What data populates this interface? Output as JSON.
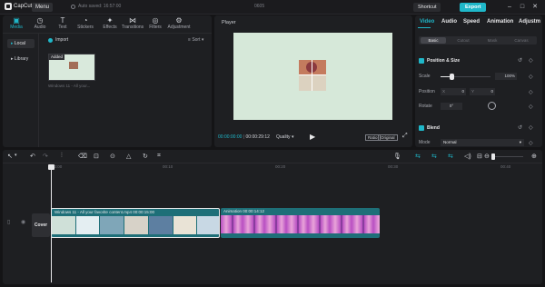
{
  "app": {
    "name": "CapCut",
    "menu": "Menu",
    "autosave": "Auto saved: 16:57:00",
    "project": "0605",
    "shortcut": "Shortcut",
    "export": "Export"
  },
  "toolbar": [
    {
      "label": "Media",
      "icon": "media-icon"
    },
    {
      "label": "Audio",
      "icon": "audio-icon"
    },
    {
      "label": "Text",
      "icon": "text-icon"
    },
    {
      "label": "Stickers",
      "icon": "stickers-icon"
    },
    {
      "label": "Effects",
      "icon": "effects-icon"
    },
    {
      "label": "Transitions",
      "icon": "transitions-icon"
    },
    {
      "label": "Filters",
      "icon": "filters-icon"
    },
    {
      "label": "Adjustment",
      "icon": "adjustment-icon"
    }
  ],
  "media": {
    "local": "Local",
    "library": "Library",
    "import": "Import",
    "sort": "Sort",
    "thumb_badge": "Added",
    "thumb_name": "Windows 11 - All your..."
  },
  "player": {
    "title": "Player",
    "time_current": "00:00:00:00",
    "time_total": "00:00:29:12",
    "quality": "Quality",
    "ratio": "Ratio",
    "original": "Original"
  },
  "inspector": {
    "tabs": [
      "Video",
      "Audio",
      "Speed",
      "Animation",
      "Adjustm"
    ],
    "subtabs": [
      "Basic",
      "Cutout",
      "Mask",
      "Canvas"
    ],
    "pos_size": "Position & Size",
    "scale": "Scale",
    "scale_val": "100%",
    "position": "Position",
    "pos_x": "0",
    "pos_y": "0",
    "x": "X",
    "y": "Y",
    "rotate": "Rotate",
    "rotate_val": "0°",
    "blend": "Blend",
    "mode": "Mode",
    "mode_val": "Normal"
  },
  "timeline": {
    "ruler": [
      "00:00",
      "00:10",
      "00:20",
      "00:30",
      "00:40"
    ],
    "cover": "Cover",
    "clip1_title": "Windows 11 - All your favorite content.mp4",
    "clip1_time": "00:00:15:00",
    "clip2_title": "Animation",
    "clip2_time": "00:00:14:12"
  },
  "colors": {
    "accent": "#1fb7c9",
    "clip": "#1e6f78"
  }
}
